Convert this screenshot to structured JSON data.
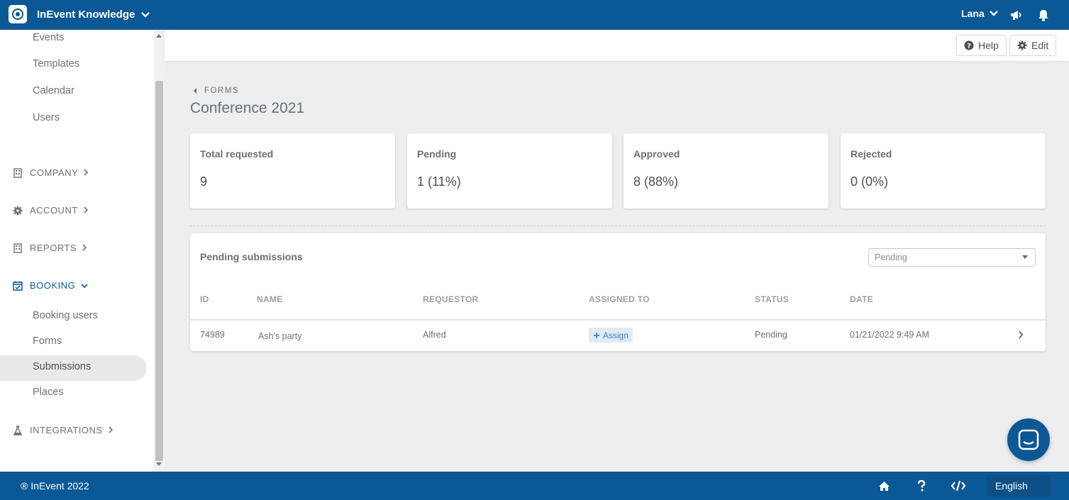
{
  "app": {
    "name": "InEvent Knowledge",
    "user": "Lana"
  },
  "sidebar": {
    "sub_items_top": [
      "Events",
      "Templates",
      "Calendar",
      "Users"
    ],
    "sections": {
      "company": "COMPANY",
      "account": "ACCOUNT",
      "reports": "REPORTS",
      "booking": "BOOKING",
      "integrations": "INTEGRATIONS"
    },
    "booking_items": [
      "Booking users",
      "Forms",
      "Submissions",
      "Places"
    ],
    "active_item": "Submissions"
  },
  "header": {
    "help_label": "Help",
    "edit_label": "Edit"
  },
  "breadcrumb": {
    "label": "FORMS"
  },
  "page": {
    "title": "Conference 2021"
  },
  "stats": [
    {
      "label": "Total requested",
      "value": "9"
    },
    {
      "label": "Pending",
      "value": "1 (11%)"
    },
    {
      "label": "Approved",
      "value": "8 (88%)"
    },
    {
      "label": "Rejected",
      "value": "0 (0%)"
    }
  ],
  "submissions": {
    "title": "Pending submissions",
    "filter_value": "Pending",
    "columns": [
      "ID",
      "NAME",
      "REQUESTOR",
      "ASSIGNED TO",
      "STATUS",
      "DATE"
    ],
    "rows": [
      {
        "id": "74989",
        "name": "Ash's party",
        "requestor": "Alfred",
        "assign_label": "Assign",
        "status": "Pending",
        "date": "01/21/2022 9:49 AM"
      }
    ]
  },
  "footer": {
    "copyright": "® InEvent 2022",
    "language": "English"
  },
  "colors": {
    "primary": "#0b5896",
    "background": "#eceeef"
  }
}
